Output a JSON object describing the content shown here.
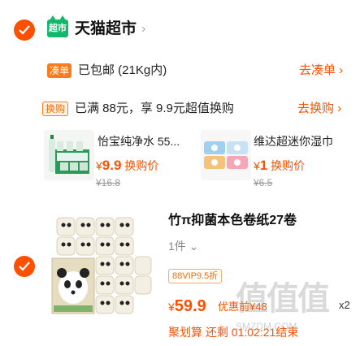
{
  "store": {
    "logo_text": "超市",
    "name": "天猫超市",
    "arrow": "›"
  },
  "shipping": {
    "tag": "凑单",
    "text": "已包邮 (21Kg内)",
    "link": "去凑单 ›"
  },
  "exchange": {
    "tag": "换购",
    "text": "已满 88元，享 9.9元超值换购",
    "link": "去换购 ›"
  },
  "gifts": [
    {
      "title": "怡宝纯净水 55...",
      "currency": "¥",
      "price": "9.9",
      "action": "换购价",
      "orig": "¥16.8"
    },
    {
      "title": "维达超迷你湿巾",
      "currency": "¥",
      "price": "1",
      "action": "换购价",
      "orig": "¥6.5"
    }
  ],
  "product": {
    "title": "竹π抑菌本色卷纸27卷",
    "qty": "1件 ⌄",
    "vip": "88VIP9.5折",
    "currency": "¥",
    "price": "59.9",
    "coupon": "优惠前¥48",
    "times": "x2",
    "promo": "聚划算 还剩 01:02:21结束"
  },
  "watermark": {
    "main": "值值值",
    "sub": "SMZDM.COM"
  },
  "colors": {
    "accent": "#ff5000",
    "tmall_green": "#15b86a"
  },
  "icons": [
    "check-icon",
    "tmall-logo-icon",
    "chevron-right-icon",
    "chevron-down-icon"
  ]
}
